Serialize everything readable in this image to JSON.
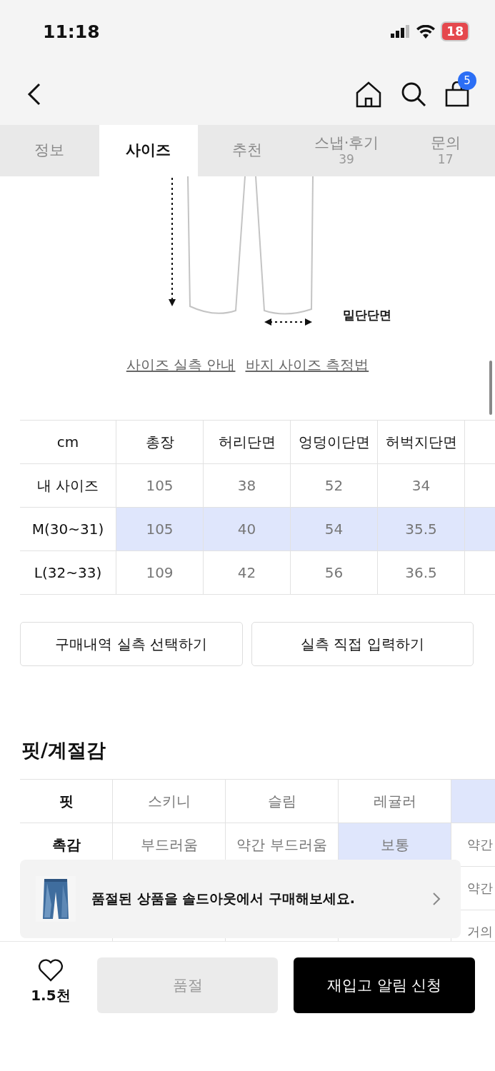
{
  "status_bar": {
    "time": "11:18",
    "battery": "18"
  },
  "nav": {
    "cart_count": "5"
  },
  "tabs": [
    {
      "label": "정보",
      "selected": false
    },
    {
      "label": "사이즈",
      "selected": true
    },
    {
      "label": "추천",
      "selected": false
    },
    {
      "label": "스냅·후기",
      "count": "39",
      "selected": false
    },
    {
      "label": "문의",
      "count": "17",
      "selected": false
    }
  ],
  "diagram": {
    "label": "밑단단면"
  },
  "links": [
    "사이즈 실측 안내",
    "바지 사이즈 측정법"
  ],
  "size_table": {
    "columns": [
      "cm",
      "총장",
      "허리단면",
      "엉덩이단면",
      "허벅지단면"
    ],
    "rows": [
      {
        "size": "내 사이즈",
        "values": [
          "105",
          "38",
          "52",
          "34"
        ],
        "selected": false
      },
      {
        "size": "M(30~31)",
        "values": [
          "105",
          "40",
          "54",
          "35.5"
        ],
        "selected": true
      },
      {
        "size": "L(32~33)",
        "values": [
          "109",
          "42",
          "56",
          "36.5"
        ],
        "selected": false
      }
    ]
  },
  "size_buttons": [
    "구매내역 실측 선택하기",
    "실측 직접 입력하기"
  ],
  "fit": {
    "title": "핏/계절감",
    "rows": [
      {
        "label": "핏",
        "cells": [
          {
            "text": "스키니",
            "selected": false
          },
          {
            "text": "슬림",
            "selected": false
          },
          {
            "text": "레귤러",
            "selected": false
          },
          {
            "selected": true
          }
        ]
      },
      {
        "label": "촉감",
        "cells": [
          {
            "text": "부드러움",
            "selected": false
          },
          {
            "text": "약간 부드러움",
            "selected": false
          },
          {
            "text": "보통",
            "selected": true
          },
          {
            "text": "약간",
            "selected": false
          }
        ]
      },
      {
        "cells": [
          {
            "text": "약간",
            "selected": false
          }
        ]
      },
      {
        "cells": [
          {
            "text": "거의",
            "selected": false
          }
        ]
      }
    ]
  },
  "banner": {
    "text": "품절된 상품을 솔드아웃에서 구매해보세요."
  },
  "bottom_bar": {
    "likes": "1.5천",
    "sold_out_button": "품절",
    "restock_button": "재입고 알림 신청"
  }
}
